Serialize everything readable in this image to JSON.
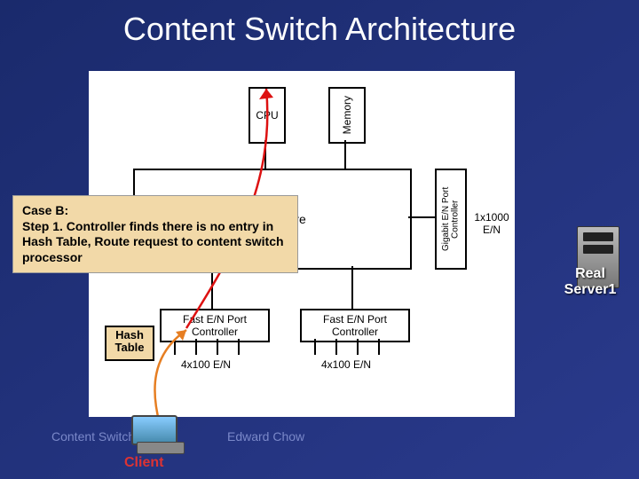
{
  "title": "Content Switch Architecture",
  "diagram": {
    "cpu": "CPU",
    "memory": "Memory",
    "switch_core": "Switch Core",
    "gig_port_ctrl": "Gigabit E/N Port Controller",
    "gig_port_lbl": "1x1000 E/N",
    "fast_port_ctrl_left": "Fast E/N Port Controller",
    "fast_port_ctrl_right": "Fast E/N Port Controller",
    "fast_port_lbl_left": "4x100 E/N",
    "fast_port_lbl_right": "4x100 E/N"
  },
  "callout": {
    "heading": "Case B:",
    "body": "Step 1. Controller finds there is no entry in Hash Table, Route request to content switch processor"
  },
  "hash_table": "Hash Table",
  "server_label": "Real Server1",
  "client_label": "Client",
  "footer": {
    "left": "Content Switch",
    "mid": "Edward Chow"
  }
}
